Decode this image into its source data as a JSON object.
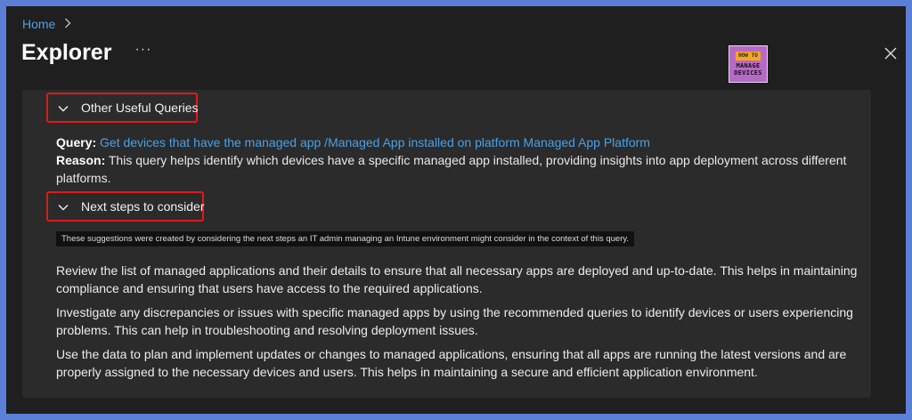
{
  "breadcrumb": {
    "home": "Home"
  },
  "header": {
    "title": "Explorer",
    "more_label": "···",
    "close_icon": "close-icon"
  },
  "logo": {
    "line1": "HOW TO",
    "line2": "MANAGE",
    "line3": "DEVICES"
  },
  "sections": {
    "other_queries": {
      "label": "Other Useful Queries",
      "query_label": "Query:",
      "query_link": "Get devices that have the managed app /Managed App installed on platform Managed App Platform",
      "reason_label": "Reason:",
      "reason_text": "This query helps identify which devices have a specific managed app installed, providing insights into app deployment across different platforms."
    },
    "next_steps": {
      "label": "Next steps to consider",
      "tooltip": "These suggestions were created by considering the next steps an IT admin managing an Intune environment might consider in the context of this query.",
      "paragraphs": [
        "Review the list of managed applications and their details to ensure that all necessary apps are deployed and up-to-date. This helps in maintaining compliance and ensuring that users have access to the required applications.",
        "Investigate any discrepancies or issues with specific managed apps by using the recommended queries to identify devices or users experiencing problems. This can help in troubleshooting and resolving deployment issues.",
        "Use the data to plan and implement updates or changes to managed applications, ensuring that all apps are running the latest versions and are properly assigned to the necessary devices and users. This helps in maintaining a secure and efficient application environment."
      ]
    }
  },
  "colors": {
    "background": "#1f1f1f",
    "panel": "#2b2b2b",
    "link": "#4aa0e6",
    "highlight": "#e01a1a",
    "frame": "#5b7fd6"
  }
}
